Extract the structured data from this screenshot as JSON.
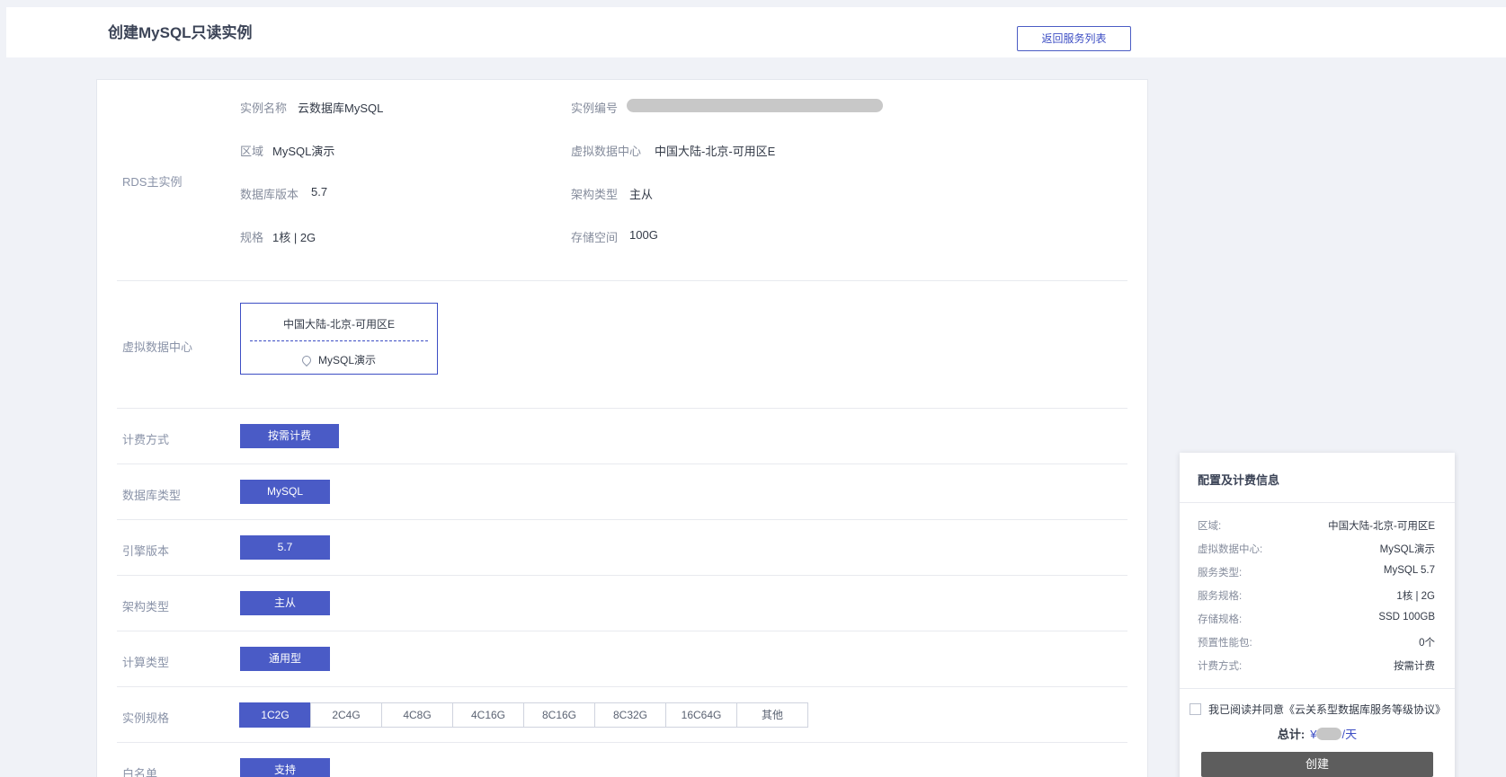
{
  "header": {
    "title": "创建MySQL只读实例",
    "back_button": "返回服务列表"
  },
  "master_section": {
    "label": "RDS主实例",
    "fields": [
      {
        "key": "实例名称",
        "value": "云数据库MySQL"
      },
      {
        "key": "实例编号",
        "value": ""
      },
      {
        "key": "区域",
        "value": "MySQL演示"
      },
      {
        "key": "虚拟数据中心",
        "value": "中国大陆-北京-可用区E"
      },
      {
        "key": "数据库版本",
        "value": "5.7"
      },
      {
        "key": "架构类型",
        "value": "主从"
      },
      {
        "key": "规格",
        "value": "1核 | 2G"
      },
      {
        "key": "存储空间",
        "value": "100G"
      }
    ]
  },
  "vdc_section": {
    "label": "虚拟数据中心",
    "card_top": "中国大陆-北京-可用区E",
    "card_bottom": "MySQL演示",
    "icon": "location-pin-icon"
  },
  "form": {
    "billing": {
      "label": "计费方式",
      "option": "按需计费"
    },
    "db_type": {
      "label": "数据库类型",
      "option": "MySQL"
    },
    "engine": {
      "label": "引擎版本",
      "option": "5.7"
    },
    "arch": {
      "label": "架构类型",
      "option": "主从"
    },
    "compute": {
      "label": "计算类型",
      "option": "通用型"
    },
    "spec": {
      "label": "实例规格",
      "options": [
        "1C2G",
        "2C4G",
        "4C8G",
        "4C16G",
        "8C16G",
        "8C32G",
        "16C64G",
        "其他"
      ],
      "selected": "1C2G"
    },
    "whitelist": {
      "label": "白名单",
      "option": "支持"
    }
  },
  "summary": {
    "title": "配置及计费信息",
    "rows": [
      {
        "key": "区域:",
        "value": "中国大陆-北京-可用区E"
      },
      {
        "key": "虚拟数据中心:",
        "value": "MySQL演示"
      },
      {
        "key": "服务类型:",
        "value": "MySQL 5.7"
      },
      {
        "key": "服务规格:",
        "value": "1核 | 2G"
      },
      {
        "key": "存储规格:",
        "value": "SSD 100GB"
      },
      {
        "key": "预置性能包:",
        "value": "0个"
      },
      {
        "key": "计费方式:",
        "value": "按需计费"
      }
    ],
    "agreement": "我已阅读并同意《云关系型数据库服务等级协议》",
    "total_label": "总计:",
    "currency": "¥",
    "per_day": "/天",
    "create_button": "创建"
  },
  "colors": {
    "accent": "#4a5bc6",
    "page_bg": "#f0f2f7",
    "disabled_button": "#5d5d5d"
  }
}
